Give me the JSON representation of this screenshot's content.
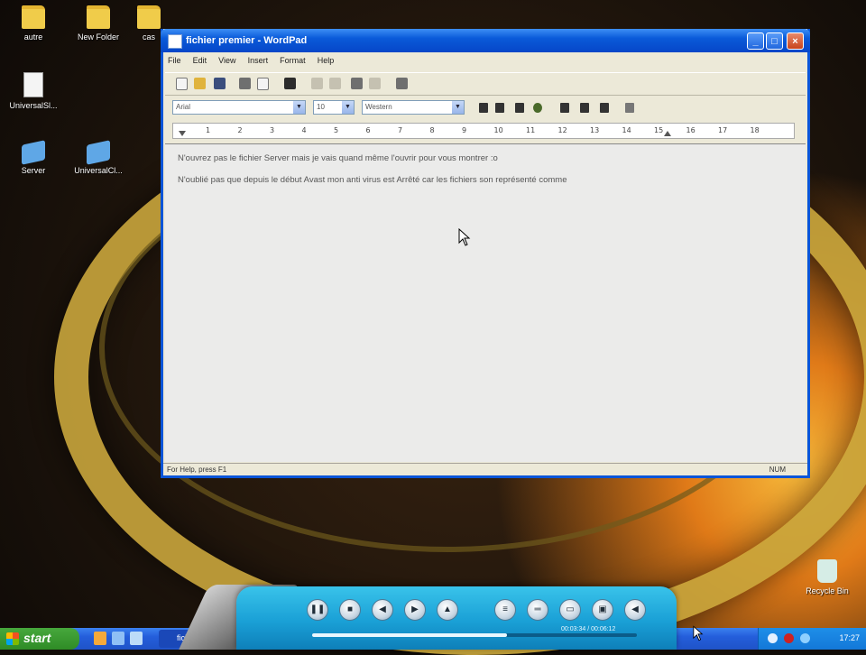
{
  "desktop": {
    "icons": [
      {
        "label": "autre",
        "icon": "folder-icon"
      },
      {
        "label": "New Folder",
        "icon": "folder-icon"
      },
      {
        "label": "cas",
        "icon": "folder-icon"
      },
      {
        "label": "UniversalSl...",
        "icon": "document-icon"
      },
      {
        "label": "Server",
        "icon": "network-icon"
      },
      {
        "label": "UniversalCl...",
        "icon": "network-icon"
      },
      {
        "label": "Recycle Bin",
        "icon": "recycle-bin-icon"
      }
    ]
  },
  "window": {
    "title": "fichier premier - WordPad",
    "buttons": {
      "minimize": "_",
      "maximize": "□",
      "close": "×"
    },
    "menu": [
      "File",
      "Edit",
      "View",
      "Insert",
      "Format",
      "Help"
    ],
    "toolbar_icons": [
      "new-icon",
      "open-icon",
      "save-icon",
      "print-icon",
      "print-preview-icon",
      "find-icon",
      "cut-icon",
      "copy-icon",
      "paste-icon",
      "undo-icon",
      "date-time-icon"
    ],
    "format": {
      "font": "Arial",
      "size": "10",
      "script": "Western",
      "buttons": [
        "bold-icon",
        "italic-icon",
        "underline-icon",
        "color-icon",
        "align-left-icon",
        "align-center-icon",
        "align-right-icon",
        "bullets-icon"
      ]
    },
    "ruler": [
      "1",
      "2",
      "3",
      "4",
      "5",
      "6",
      "7",
      "8",
      "9",
      "10",
      "11",
      "12",
      "13",
      "14",
      "15",
      "16",
      "17",
      "18"
    ],
    "document": {
      "paragraphs": [
        "N'ouvrez pas le fichier Server mais je vais quand même l'ouvrir pour vous montrer :o",
        "N'oublié pas que depuis le début Avast mon anti virus est Arrêté car les fichiers son représenté comme"
      ]
    },
    "status": {
      "text": "For Help, press F1",
      "mode": "NUM"
    }
  },
  "taskbar": {
    "start_label": "start",
    "task_item": "fich...",
    "clock": "17:27"
  },
  "player": {
    "controls": [
      "pause-icon",
      "stop-icon",
      "previous-icon",
      "next-icon",
      "eject-icon",
      "playlist-icon",
      "equalizer-icon",
      "fullscreen-icon",
      "screen-icon",
      "mute-icon"
    ],
    "progress": 0.6,
    "timecode": "00:03:34 / 00:06:12"
  }
}
